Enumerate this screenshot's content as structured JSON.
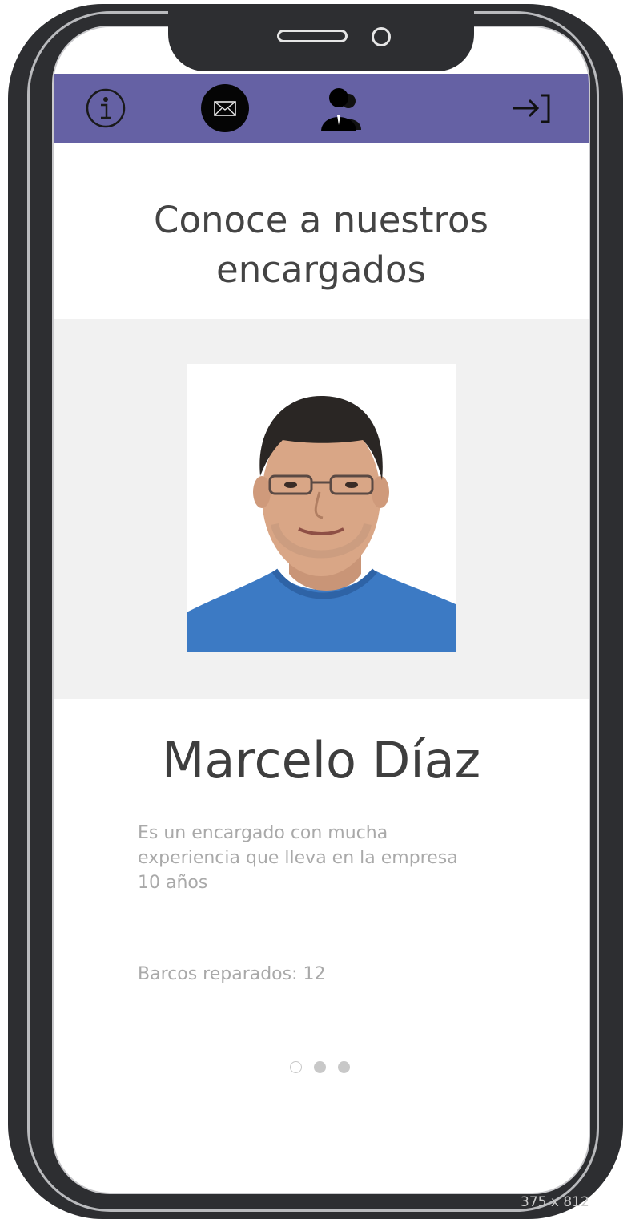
{
  "navbar": {
    "background": "#6561a4",
    "icons": [
      "info-icon",
      "mail-icon",
      "team-icon",
      "login-icon"
    ]
  },
  "page": {
    "title_line1": "Conoce a nuestros",
    "title_line2": "encargados"
  },
  "profile": {
    "name": "Marcelo Díaz",
    "description_line1": "Es un encargado con mucha",
    "description_line2": "experiencia que lleva en la empresa",
    "description_line3": "10 años",
    "repaired": "Barcos reparados: 12",
    "photo": "portrait-photo"
  },
  "carousel": {
    "total": 3,
    "active_index": 0
  },
  "device": {
    "size_label": "375 x 812"
  }
}
